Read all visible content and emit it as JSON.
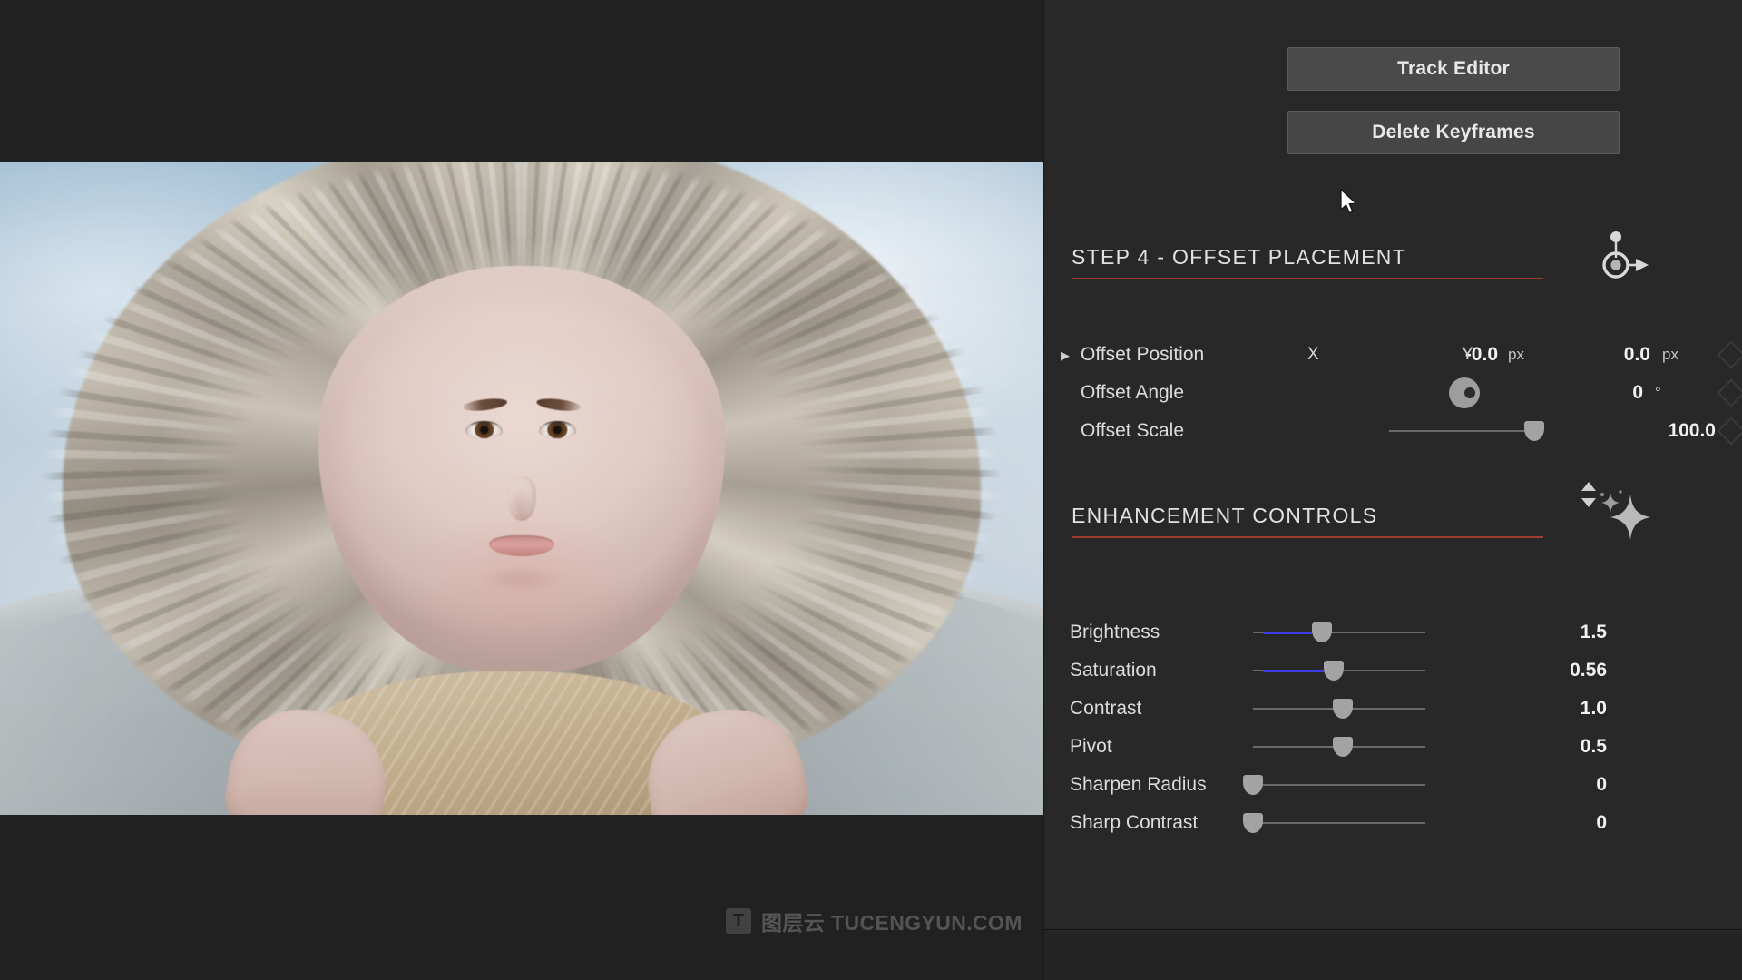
{
  "app": {
    "accent_red": "#9e3a30",
    "slider_blue": "#3c3ce8",
    "panel_bg": "#282828"
  },
  "viewer": {
    "name": "video-preview",
    "watermark": {
      "badge_glyph": "T",
      "text": "图层云 TUCENGYUN.COM"
    }
  },
  "inspector": {
    "actions": {
      "track_editor_label": "Track Editor",
      "delete_keyframes_label": "Delete Keyframes"
    },
    "sections": [
      {
        "id": "step4",
        "title": "STEP 4 - OFFSET PLACEMENT",
        "icon": "offset-anchor-icon"
      },
      {
        "id": "enhancement",
        "title": "ENHANCEMENT CONTROLS",
        "icon": "sparkle-icon"
      }
    ],
    "offset_placement": {
      "position": {
        "label": "Offset Position",
        "disclosure": "▶",
        "x_tag": "X",
        "x_value": "-0.0",
        "x_unit": "px",
        "y_tag": "Y",
        "y_value": "0.0",
        "y_unit": "px"
      },
      "angle": {
        "label": "Offset Angle",
        "value": "0",
        "unit": "°",
        "dial_rotation_deg": 0
      },
      "scale": {
        "label": "Offset Scale",
        "value": "100.0",
        "thumb_percent": 100
      }
    },
    "enhancement_controls": [
      {
        "label": "Brightness",
        "value": "1.5",
        "thumb_percent": 40,
        "fill_percent": 40,
        "has_fill": true
      },
      {
        "label": "Saturation",
        "value": "0.56",
        "thumb_percent": 47,
        "fill_percent": 47,
        "has_fill": true
      },
      {
        "label": "Contrast",
        "value": "1.0",
        "thumb_percent": 52,
        "fill_percent": 0,
        "has_fill": false
      },
      {
        "label": "Pivot",
        "value": "0.5",
        "thumb_percent": 52,
        "fill_percent": 0,
        "has_fill": false
      },
      {
        "label": "Sharpen Radius",
        "value": "0",
        "thumb_percent": 0,
        "fill_percent": 0,
        "has_fill": false
      },
      {
        "label": "Sharp Contrast",
        "value": "0",
        "thumb_percent": 0,
        "fill_percent": 0,
        "has_fill": false
      }
    ],
    "keyframe_indicators": 3,
    "expand_control": "expand-collapse-chevrons"
  }
}
